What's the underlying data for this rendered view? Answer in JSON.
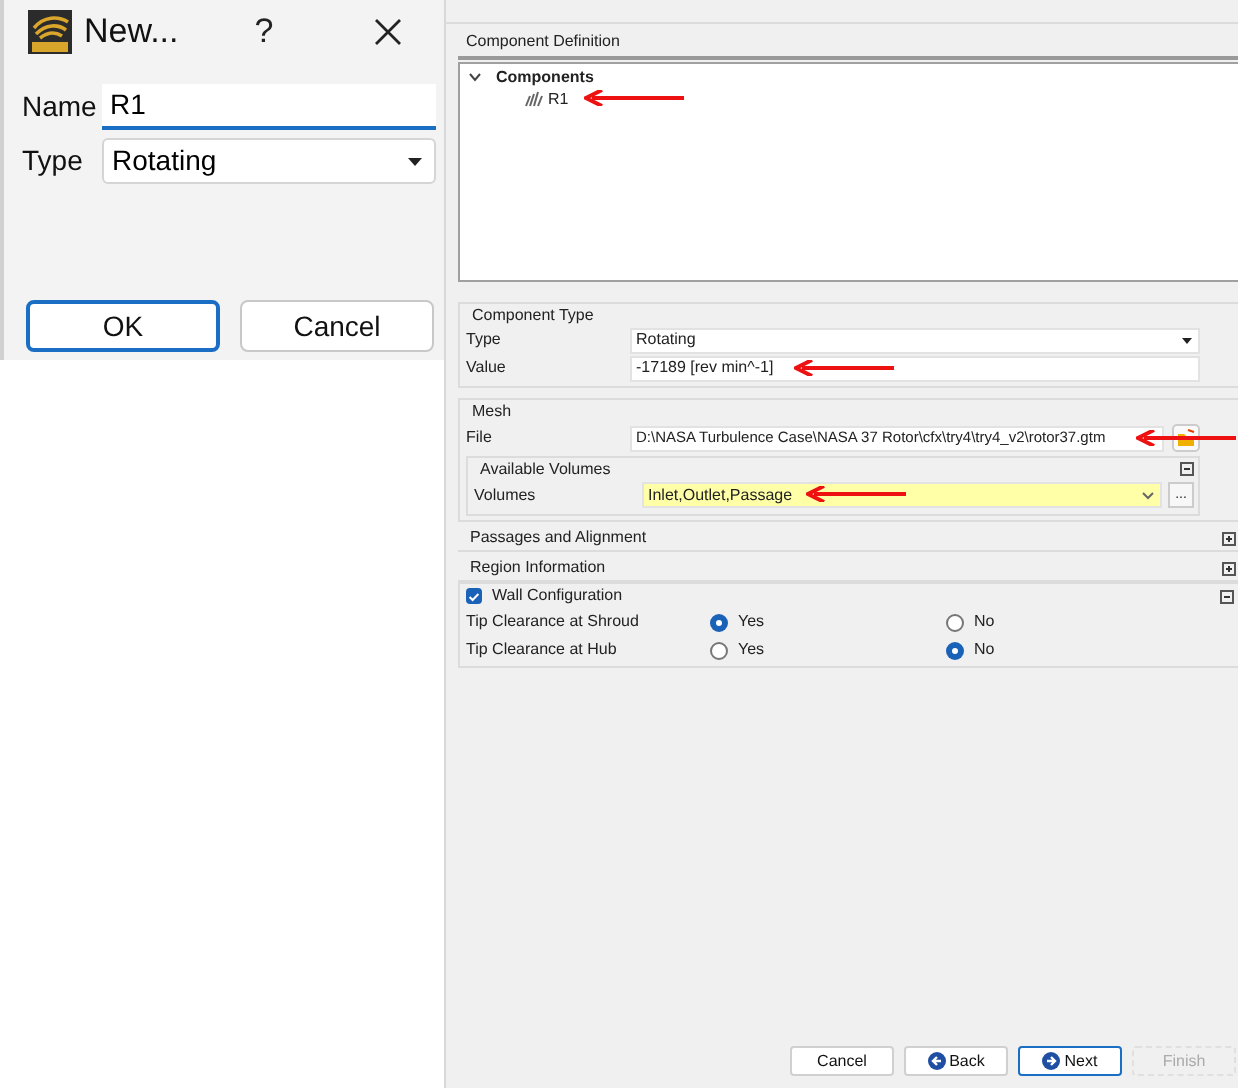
{
  "new_dialog": {
    "title": "New...",
    "help": "?",
    "fields": [
      {
        "label": "Name",
        "kind": "text",
        "value": "R1"
      },
      {
        "label": "Type",
        "kind": "select",
        "value": "Rotating"
      }
    ],
    "buttons": [
      {
        "label": "OK",
        "focused": true
      },
      {
        "label": "Cancel",
        "focused": false
      }
    ]
  },
  "component_definition": {
    "title": "Component Definition",
    "tree": [
      {
        "label": "Components",
        "expanded": true,
        "children": [
          {
            "label": "R1"
          }
        ]
      }
    ]
  },
  "component_type": {
    "title": "Component Type",
    "type_label": "Type",
    "type_value": "Rotating",
    "value_label": "Value",
    "value": "-17189 [rev min^-1]"
  },
  "mesh": {
    "title": "Mesh",
    "file_label": "File",
    "file": "D:\\NASA Turbulence Case\\NASA 37 Rotor\\cfx\\try4\\try4_v2\\rotor37.gtm",
    "available_volumes": {
      "title": "Available Volumes",
      "expanded": true,
      "label": "Volumes",
      "value": "Inlet,Outlet,Passage",
      "browse": "..."
    }
  },
  "sections": [
    {
      "title": "Passages and Alignment",
      "expanded": false
    },
    {
      "title": "Region Information",
      "expanded": false
    }
  ],
  "wall_configuration": {
    "title": "Wall Configuration",
    "checked": true,
    "expanded": true,
    "rows": [
      {
        "label": "Tip Clearance at Shroud",
        "options": [
          {
            "label": "Yes",
            "selected": true
          },
          {
            "label": "No",
            "selected": false
          }
        ]
      },
      {
        "label": "Tip Clearance at Hub",
        "options": [
          {
            "label": "Yes",
            "selected": false
          },
          {
            "label": "No",
            "selected": true
          }
        ]
      }
    ]
  },
  "footer_buttons": [
    {
      "label": "Cancel",
      "kind": "plain",
      "focused": false,
      "disabled": false
    },
    {
      "label": "Back",
      "kind": "back",
      "focused": false,
      "disabled": false
    },
    {
      "label": "Next",
      "kind": "next",
      "focused": true,
      "disabled": false
    },
    {
      "label": "Finish",
      "kind": "plain",
      "focused": false,
      "disabled": true
    }
  ]
}
